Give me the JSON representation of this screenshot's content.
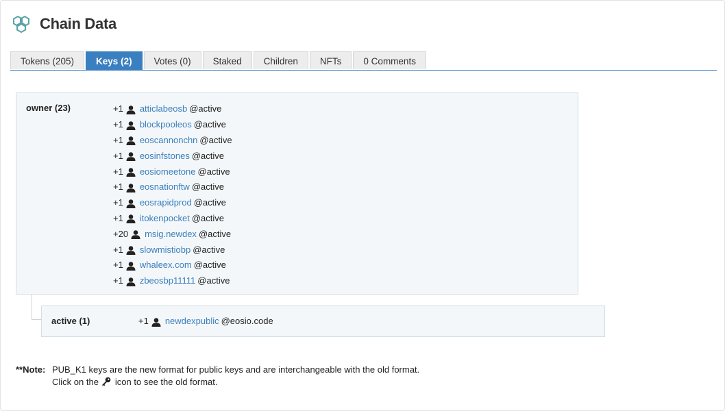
{
  "header": {
    "title": "Chain Data",
    "logo_icon": "hexagon-chain-icon"
  },
  "tabs": [
    {
      "label": "Tokens (205)",
      "active": false
    },
    {
      "label": "Keys (2)",
      "active": true
    },
    {
      "label": "Votes (0)",
      "active": false
    },
    {
      "label": "Staked",
      "active": false
    },
    {
      "label": "Children",
      "active": false
    },
    {
      "label": "NFTs",
      "active": false
    },
    {
      "label": "0 Comments",
      "active": false
    }
  ],
  "permissions": [
    {
      "name": "owner (23)",
      "accounts": [
        {
          "weight": "+1",
          "account": "atticlabeosb",
          "permission": "@active"
        },
        {
          "weight": "+1",
          "account": "blockpooleos",
          "permission": "@active"
        },
        {
          "weight": "+1",
          "account": "eoscannonchn",
          "permission": "@active"
        },
        {
          "weight": "+1",
          "account": "eosinfstones",
          "permission": "@active"
        },
        {
          "weight": "+1",
          "account": "eosiomeetone",
          "permission": "@active"
        },
        {
          "weight": "+1",
          "account": "eosnationftw",
          "permission": "@active"
        },
        {
          "weight": "+1",
          "account": "eosrapidprod",
          "permission": "@active"
        },
        {
          "weight": "+1",
          "account": "itokenpocket",
          "permission": "@active"
        },
        {
          "weight": "+20",
          "account": "msig.newdex",
          "permission": "@active"
        },
        {
          "weight": "+1",
          "account": "slowmistiobp",
          "permission": "@active"
        },
        {
          "weight": "+1",
          "account": "whaleex.com",
          "permission": "@active"
        },
        {
          "weight": "+1",
          "account": "zbeosbp11111",
          "permission": "@active"
        }
      ]
    },
    {
      "name": "active (1)",
      "accounts": [
        {
          "weight": "+1",
          "account": "newdexpublic",
          "permission": "@eosio.code"
        }
      ]
    }
  ],
  "note": {
    "label": "**Note:",
    "line1": "PUB_K1 keys are the new format for public keys and are interchangeable with the old format.",
    "line2_before": "Click on the",
    "line2_after": "icon to see the old format.",
    "icon": "key-icon"
  },
  "colors": {
    "accent": "#3a7fbf",
    "box_bg": "#f4f7f9",
    "tab_bg": "#ededed"
  }
}
